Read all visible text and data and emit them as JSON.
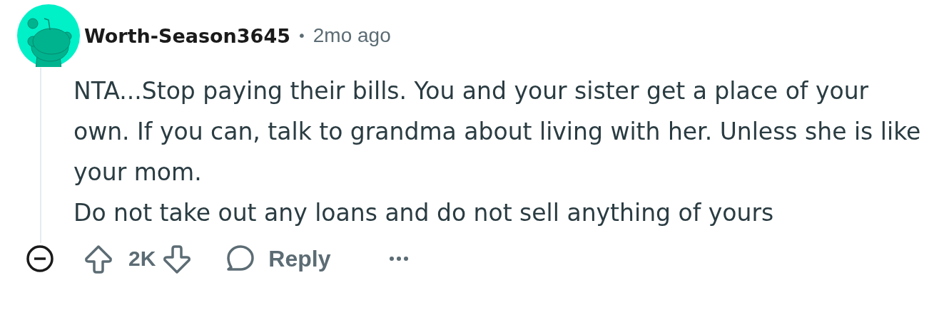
{
  "comment": {
    "author": "Worth-Season3645",
    "separator": "•",
    "time": "2mo ago",
    "paragraphs": [
      "NTA...Stop paying their bills. You and your sister get a place of your own. If you can, talk to grandma about living with her. Unless she is like your mom.",
      "Do not take out any loans and do not sell anything of yours"
    ],
    "score": "2K",
    "reply_label": "Reply"
  }
}
